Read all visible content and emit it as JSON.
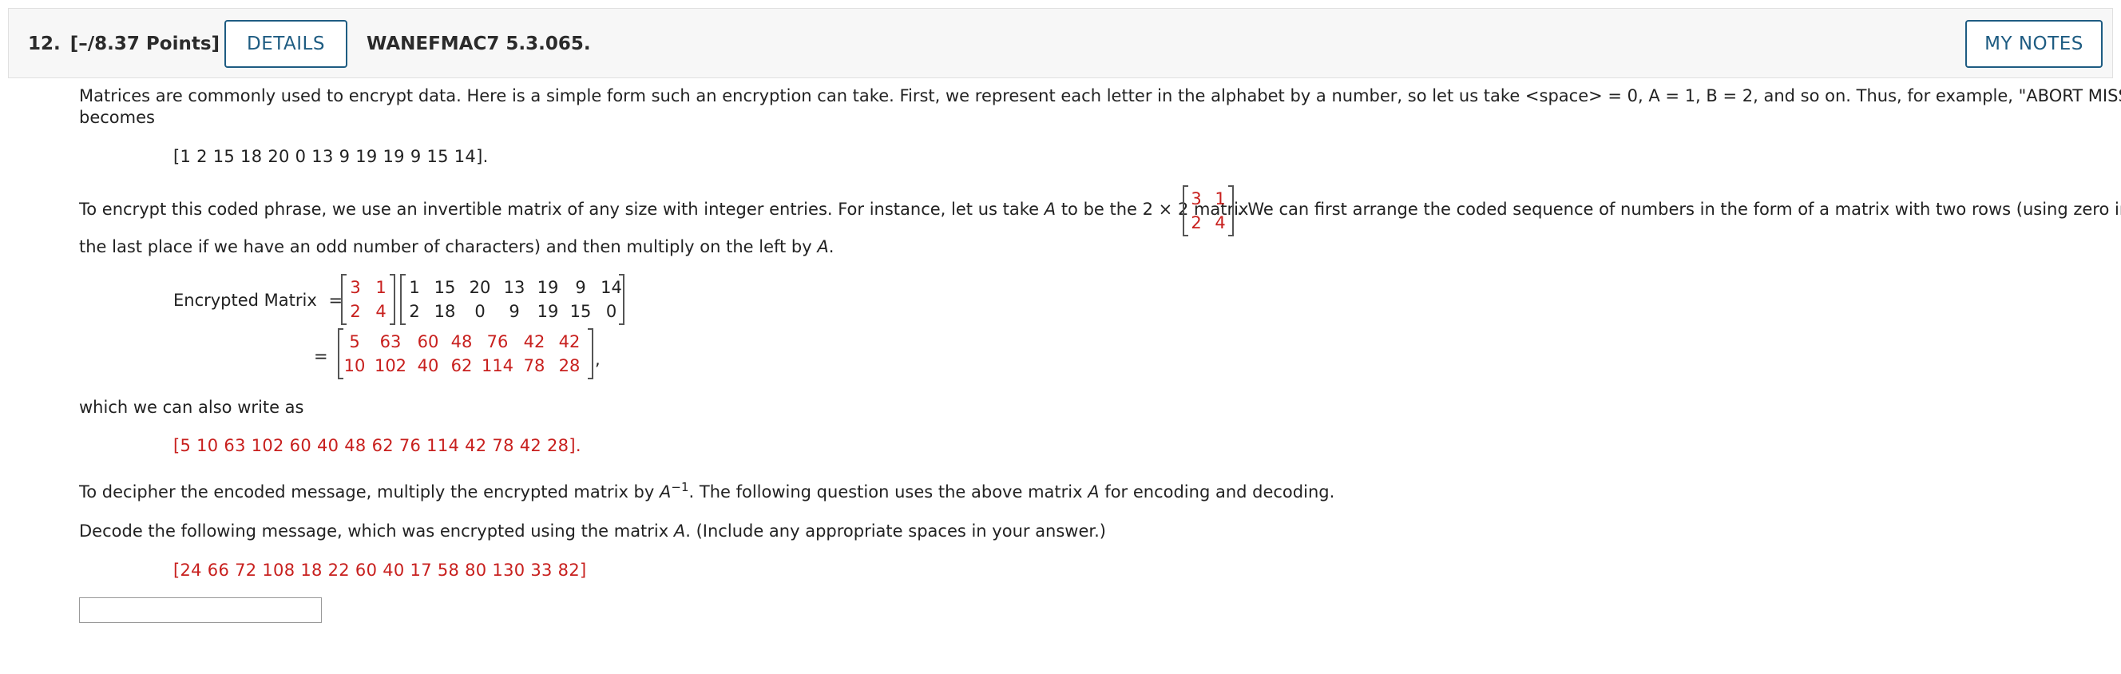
{
  "header": {
    "question_number": "12.",
    "points": "[–/8.37 Points]",
    "details_label": "DETAILS",
    "question_id": "WANEFMAC7 5.3.065.",
    "notes_label": "MY NOTES"
  },
  "body": {
    "intro_line1": "Matrices are commonly used to encrypt data. Here is a simple form such an encryption can take. First, we represent each letter in the alphabet by a number, so let us take <space> = 0, A = 1, B = 2, and so on. Thus, for example, \"ABORT MISSION\"",
    "intro_line2": "becomes",
    "coded_sequence": "[1  2  15  18  20  0  13  9  19  19  9  15  14].",
    "encrypt_text_a": "To encrypt this coded phrase, we use an invertible matrix of any size with integer entries. For instance, let us take",
    "encrypt_var": "A",
    "encrypt_text_b": "to be the 2 × 2 matrix",
    "encrypt_text_c": ". We can first arrange the coded sequence of numbers in the form of a matrix with two rows (using zero in",
    "encrypt_line2a": "the last place if we have an odd number of characters) and then multiply on the left by",
    "encrypt_line2_var": "A",
    "encrypt_line2_end": ".",
    "encrypted_label": "Encrypted Matrix",
    "equals": "=",
    "trailing_comma": ",",
    "also_write": "which we can also write as",
    "encrypted_sequence": "[5  10  63  102  60  40  48  62  76  114  42  78  42  28].",
    "decipher_a": "To decipher the encoded message, multiply the encrypted matrix by",
    "decipher_var": "A",
    "decipher_exp": "−1",
    "decipher_b": ". The following question uses the above matrix",
    "decipher_var2": "A",
    "decipher_c": "for encoding and decoding.",
    "decode_a": "Decode the following message, which was encrypted using the matrix",
    "decode_var": "A",
    "decode_b": ". (Include any appropriate spaces in your answer.)",
    "message": "[24  66  72  108  18  22  60  40  17  58  80  130  33  82]"
  },
  "matrix_A": [
    [
      "3",
      "1"
    ],
    [
      "2",
      "4"
    ]
  ],
  "matrix_coded": [
    [
      "1",
      "15",
      "20",
      "13",
      "19",
      "9",
      "14"
    ],
    [
      "2",
      "18",
      "0",
      "9",
      "19",
      "15",
      "0"
    ]
  ],
  "matrix_result": [
    [
      "5",
      "63",
      "60",
      "48",
      "76",
      "42",
      "42"
    ],
    [
      "10",
      "102",
      "40",
      "62",
      "114",
      "78",
      "28"
    ]
  ],
  "answer_value": "",
  "colors": {
    "accent": "#1e5c82",
    "highlight": "#c8201e"
  }
}
